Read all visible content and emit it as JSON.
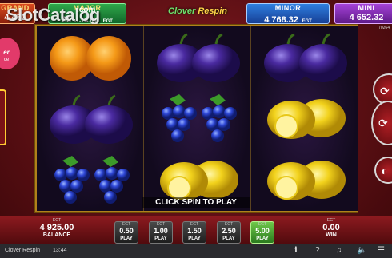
{
  "jackpots": {
    "grand": {
      "title": "GRAND",
      "value": "4 432",
      "currency": "EGT"
    },
    "major": {
      "title": "MAJOR",
      "value": "29 ...com",
      "currency": "EGT"
    },
    "minor": {
      "title": "MINOR",
      "value": "4 768.32",
      "currency": "EGT"
    },
    "mini": {
      "title": "MINI",
      "value": "4 652.32",
      "currency": "EGT"
    }
  },
  "header": {
    "logo_word1": "Clover",
    "logo_word2": "Respin",
    "watermark": "SlotCatalog",
    "watermark_suffix": ".com",
    "game_id": "70264"
  },
  "reels": [
    [
      "orange",
      "plum",
      "grapes"
    ],
    [
      "plum",
      "grapes",
      "lemon"
    ],
    [
      "plum",
      "lemon",
      "lemon"
    ]
  ],
  "call_to_action": "CLICK SPIN TO PLAY",
  "balance": {
    "currency": "EGT",
    "value": "4 925.00",
    "label": "BALANCE"
  },
  "bets": [
    {
      "currency": "EGT",
      "value": "0.50",
      "label": "PLAY",
      "active": false
    },
    {
      "currency": "EGT",
      "value": "1.00",
      "label": "PLAY",
      "active": false
    },
    {
      "currency": "EGT",
      "value": "1.50",
      "label": "PLAY",
      "active": false
    },
    {
      "currency": "EGT",
      "value": "2.50",
      "label": "PLAY",
      "active": false
    },
    {
      "currency": "EGT",
      "value": "5.00",
      "label": "PLAY",
      "active": true
    }
  ],
  "win": {
    "currency": "EGT",
    "value": "0.00",
    "label": "WIN"
  },
  "status_bar": {
    "game_name": "Clover Respin",
    "time": "13:44",
    "icons": [
      "info-icon",
      "help-icon",
      "music-icon",
      "sound-icon",
      "menu-icon"
    ]
  },
  "colors": {
    "orange": "#f08a10",
    "plum": "#4a2aa0",
    "grapes": "#2f48d8",
    "lemon": "#f2d21c",
    "leaf": "#3c9a2a"
  }
}
